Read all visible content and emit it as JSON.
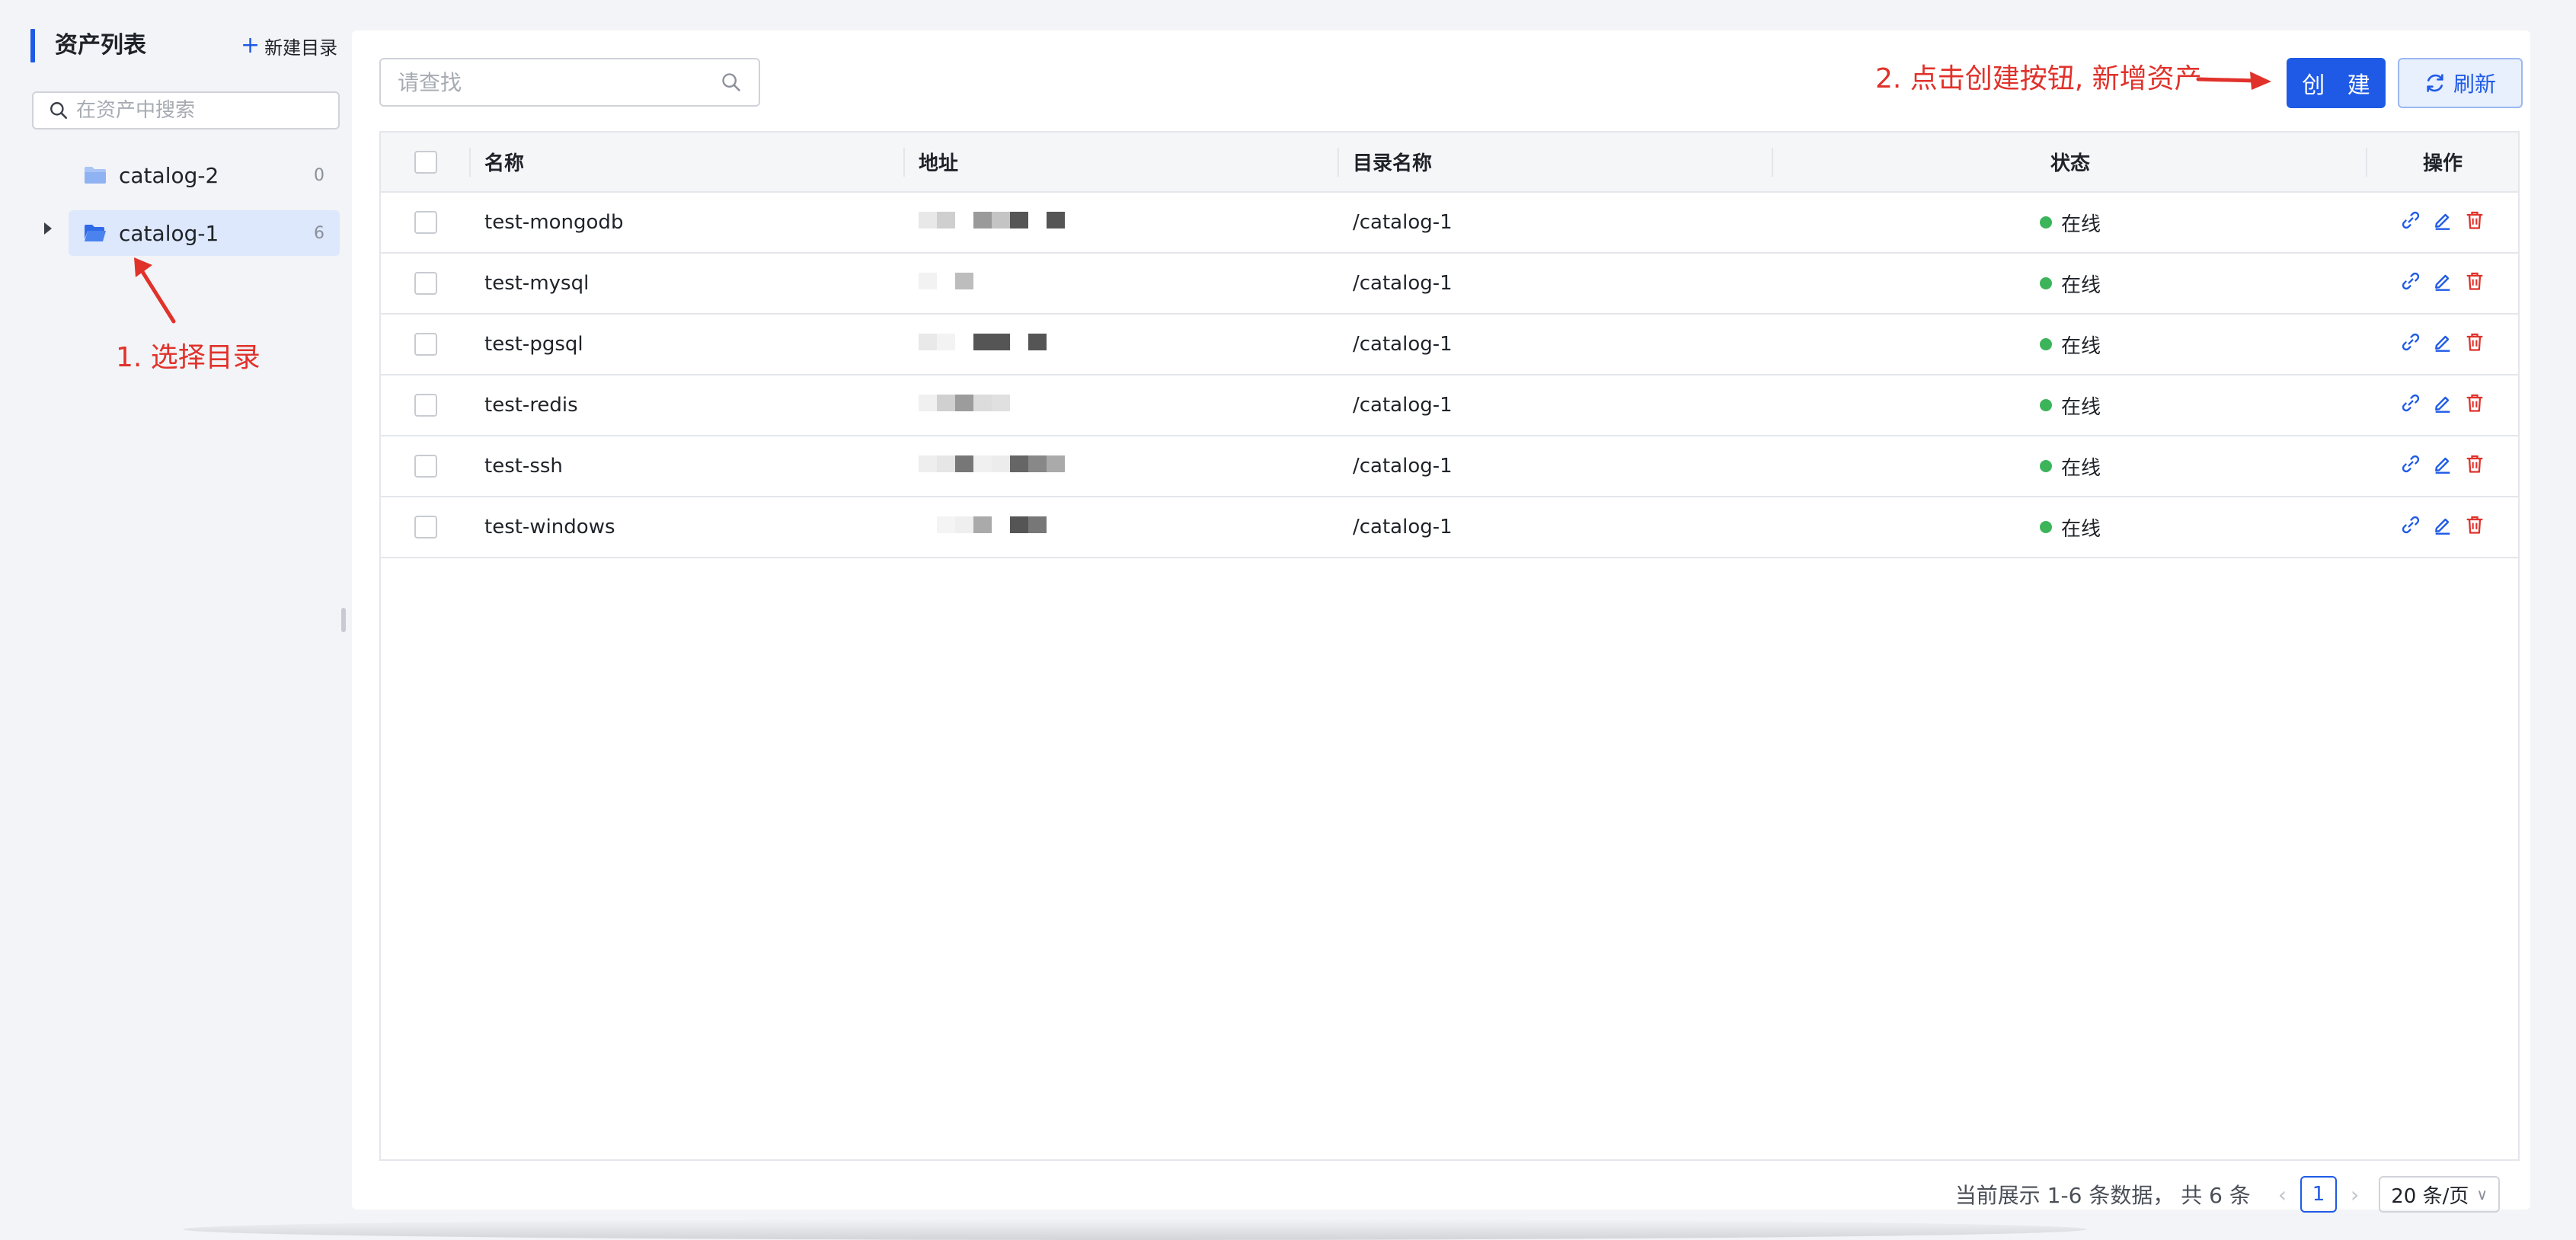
{
  "sidebar": {
    "title": "资产列表",
    "new_dir_label": "新建目录",
    "search_placeholder": "在资产中搜索",
    "tree": [
      {
        "label": "catalog-2",
        "count": "0",
        "selected": false,
        "expandable": false
      },
      {
        "label": "catalog-1",
        "count": "6",
        "selected": true,
        "expandable": true
      }
    ]
  },
  "annotations": {
    "step1": "1. 选择目录",
    "step2": "2. 点击创建按钮, 新增资产"
  },
  "toolbar": {
    "search_placeholder": "请查找",
    "create_label": "创 建",
    "refresh_label": "刷新"
  },
  "table": {
    "headers": {
      "name": "名称",
      "address": "地址",
      "catalog": "目录名称",
      "status": "状态",
      "actions": "操作"
    },
    "rows": [
      {
        "name": "test-mongodb",
        "catalog": "/catalog-1",
        "status": "在线"
      },
      {
        "name": "test-mysql",
        "catalog": "/catalog-1",
        "status": "在线"
      },
      {
        "name": "test-pgsql",
        "catalog": "/catalog-1",
        "status": "在线"
      },
      {
        "name": "test-redis",
        "catalog": "/catalog-1",
        "status": "在线"
      },
      {
        "name": "test-ssh",
        "catalog": "/catalog-1",
        "status": "在线"
      },
      {
        "name": "test-windows",
        "catalog": "/catalog-1",
        "status": "在线"
      }
    ]
  },
  "pagination": {
    "summary": "当前展示 1-6 条数据， 共 6 条",
    "current_page": "1",
    "page_size": "20 条/页"
  },
  "colors": {
    "accent": "#1f5ae6",
    "annotation": "#e0322b",
    "online": "#3cb45a",
    "danger": "#e0322b"
  },
  "icons": {
    "search": "search-icon",
    "folder": "folder-icon",
    "refresh": "refresh-icon",
    "link": "link-icon",
    "edit": "edit-icon",
    "delete": "trash-icon"
  }
}
